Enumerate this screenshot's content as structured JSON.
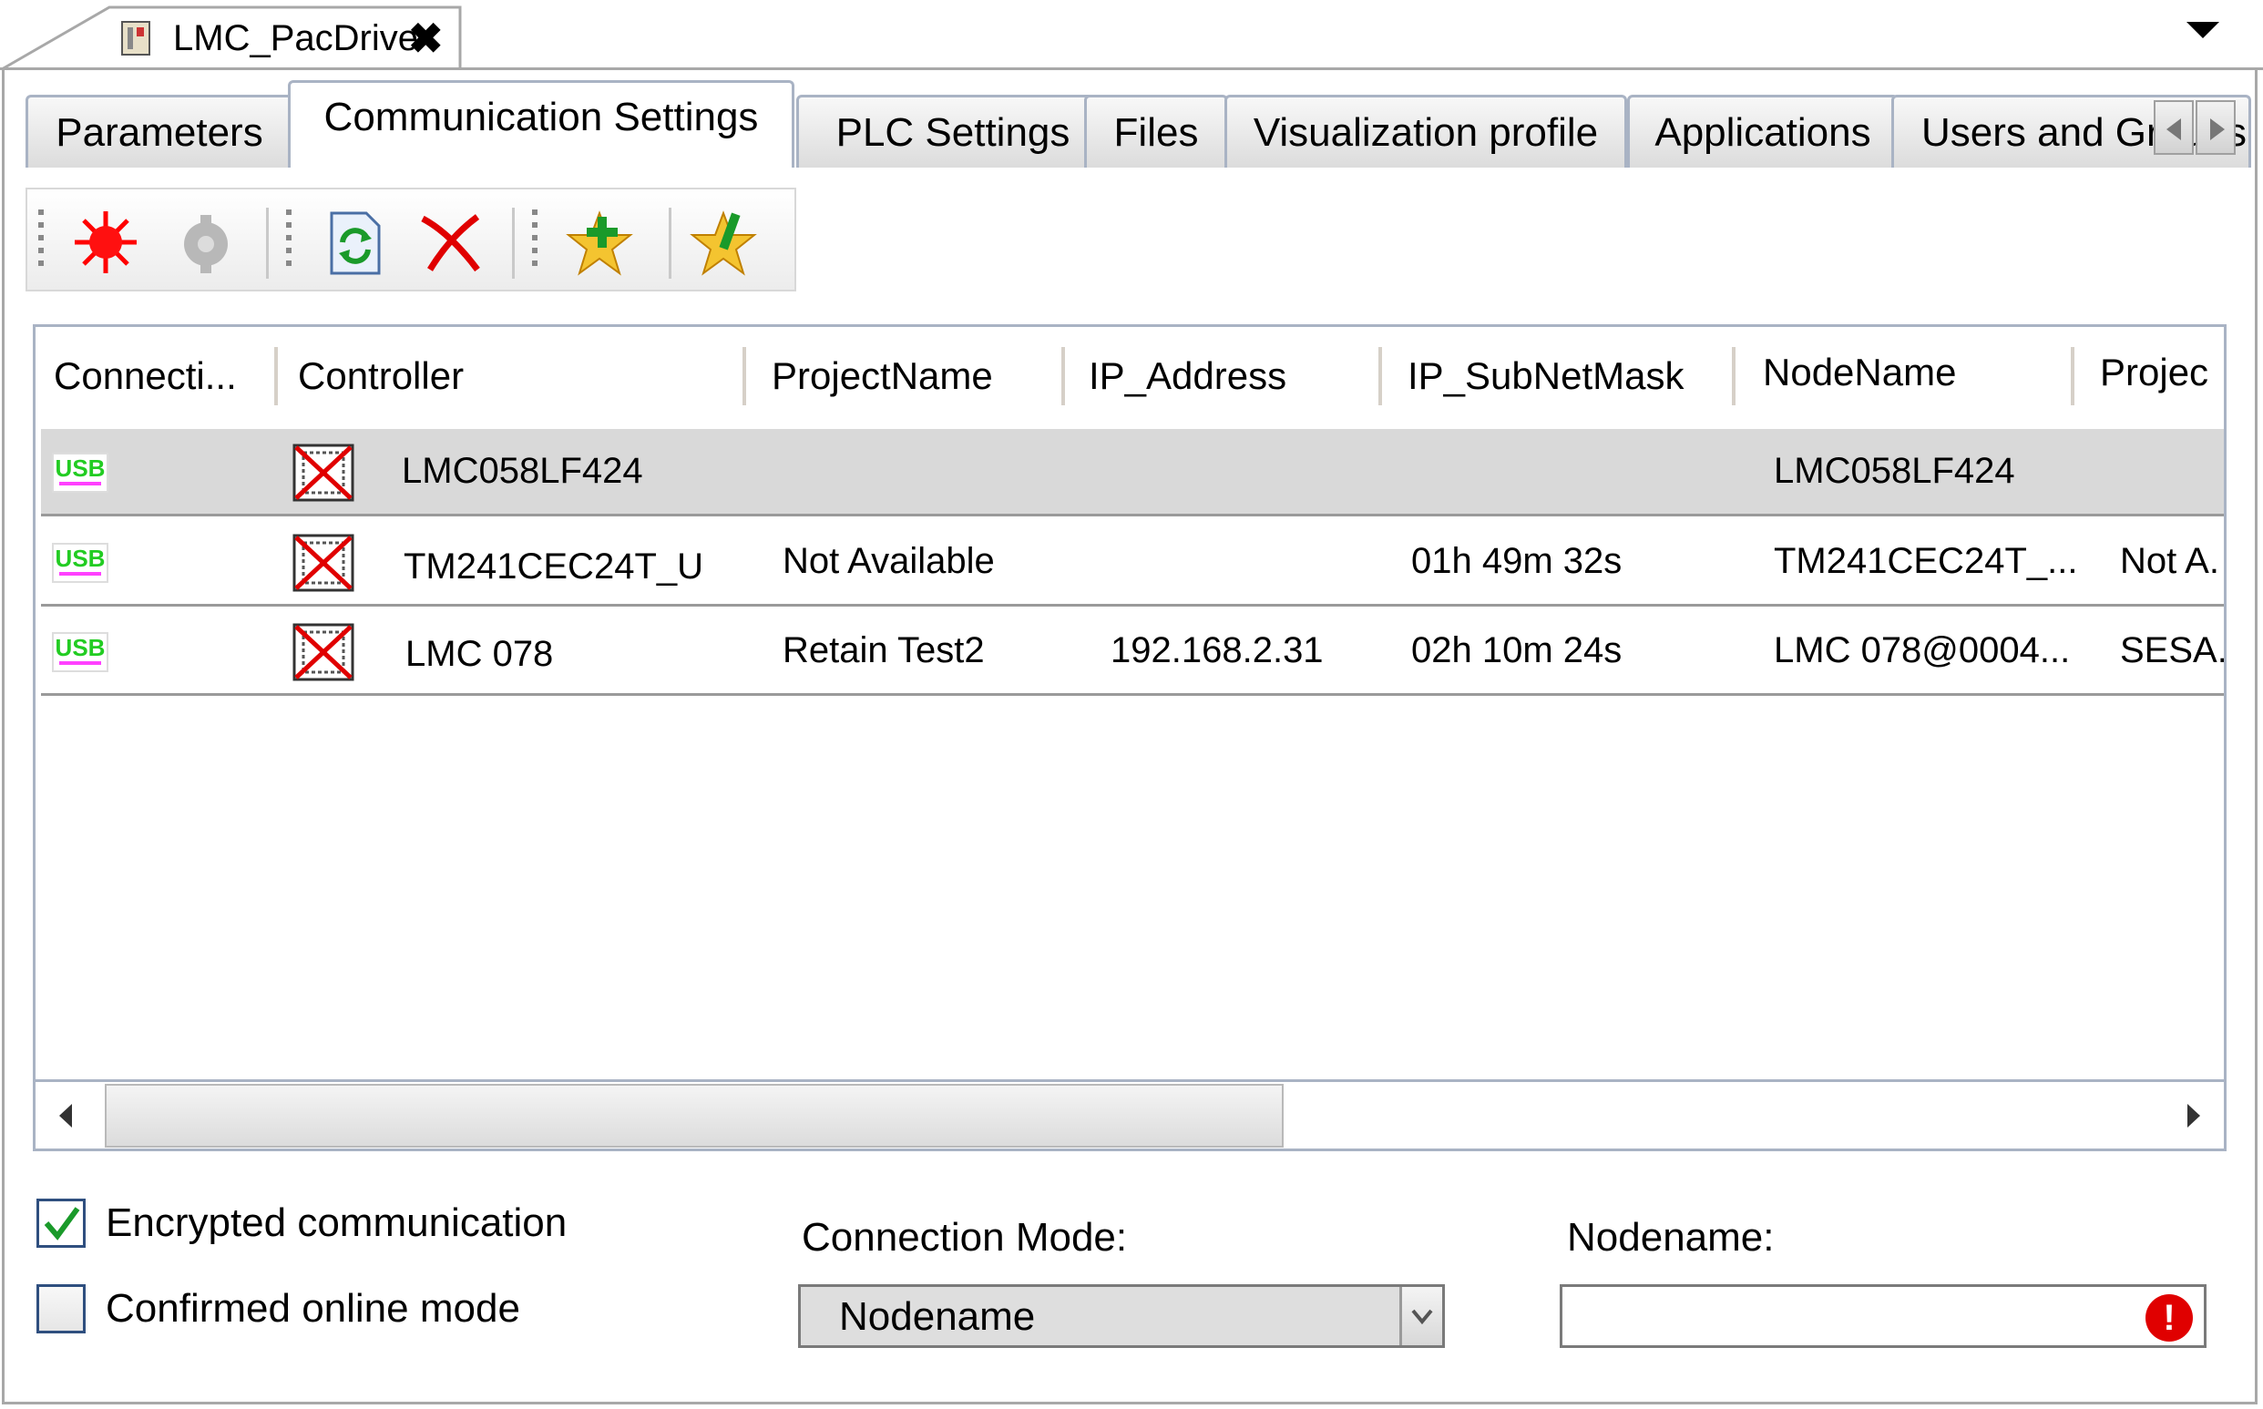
{
  "document_tab": {
    "title": "LMC_PacDrive",
    "close_glyph": "✖"
  },
  "tabs": [
    {
      "label": "Parameters",
      "active": false
    },
    {
      "label": "Communication Settings",
      "active": true
    },
    {
      "label": "PLC Settings",
      "active": false
    },
    {
      "label": "Files",
      "active": false
    },
    {
      "label": "Visualization profile",
      "active": false
    },
    {
      "label": "Applications",
      "active": false
    },
    {
      "label": "Users and Groups",
      "active": false
    }
  ],
  "toolbar": {
    "icons": [
      "wink-icon",
      "disabled-gear-icon",
      "refresh-icon",
      "delete-icon",
      "add-favorite-icon",
      "edit-favorite-icon"
    ]
  },
  "table": {
    "columns": [
      "Connecti...",
      "Controller",
      "ProjectName",
      "IP_Address",
      "IP_SubNetMask",
      "NodeName",
      "Projec"
    ],
    "rows": [
      {
        "connection": "USB",
        "controller": "LMC058LF424",
        "project_name": "",
        "ip_address": "",
        "subnet": "",
        "node_name": "LMC058LF424",
        "project": "",
        "selected": true
      },
      {
        "connection": "USB",
        "controller": "TM241CEC24T_U",
        "project_name": "Not Available",
        "ip_address": "",
        "subnet": "01h 49m 32s",
        "node_name": "TM241CEC24T_...",
        "project": "Not A.",
        "selected": false
      },
      {
        "connection": "USB",
        "controller": "LMC 078",
        "project_name": "Retain Test2",
        "ip_address": "192.168.2.31",
        "subnet": "02h 10m 24s",
        "node_name": "LMC 078@0004...",
        "project": "SESA.",
        "selected": false
      }
    ]
  },
  "options": {
    "encrypted_label": "Encrypted communication",
    "encrypted_checked": true,
    "confirmed_label": "Confirmed online mode",
    "confirmed_checked": false
  },
  "connection_mode": {
    "label": "Connection Mode:",
    "value": "Nodename"
  },
  "nodename": {
    "label": "Nodename:",
    "value": "",
    "error_glyph": "!"
  },
  "colors": {
    "accent_border": "#a9b3c4",
    "selected_row": "#d9d9d9",
    "usb_green": "#22cc22",
    "error_red": "#e00000"
  }
}
